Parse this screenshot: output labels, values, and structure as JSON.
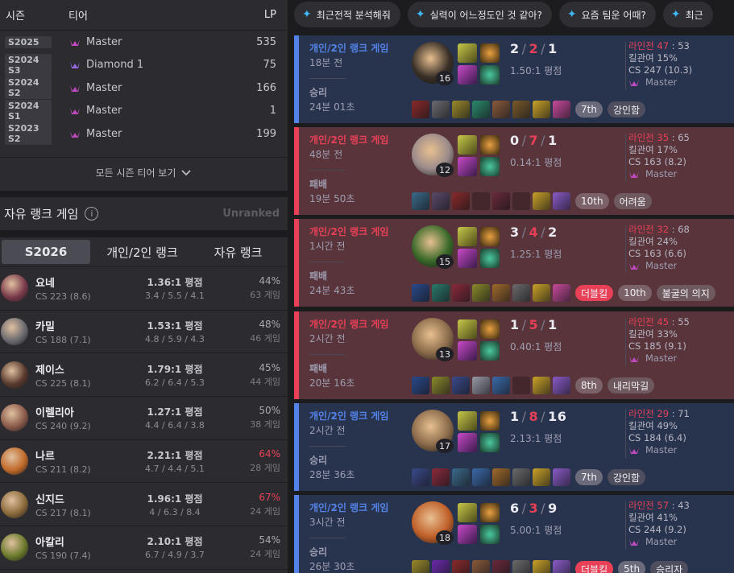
{
  "season_table": {
    "headers": {
      "season": "시즌",
      "tier": "티어",
      "lp": "LP"
    },
    "rows": [
      {
        "season": "S2025",
        "tier": "Master",
        "lp": "535",
        "icon": "master-icon"
      },
      {
        "season": "S2024 S3",
        "tier": "Diamond 1",
        "lp": "75",
        "icon": "diamond-icon"
      },
      {
        "season": "S2024 S2",
        "tier": "Master",
        "lp": "166",
        "icon": "master-icon"
      },
      {
        "season": "S2024 S1",
        "tier": "Master",
        "lp": "1",
        "icon": "master-icon"
      },
      {
        "season": "S2023 S2",
        "tier": "Master",
        "lp": "199",
        "icon": "master-icon"
      }
    ],
    "all_seasons_label": "모든 시즌 티어 보기"
  },
  "flex_rank": {
    "title": "자유 랭크 게임",
    "status": "Unranked"
  },
  "champ_tabs": [
    "S2026",
    "개인/2인 랭크",
    "자유 랭크"
  ],
  "champions": [
    {
      "name": "요네",
      "cs": "CS 223 (8.6)",
      "kda": "1.36:1 평점",
      "kda_detail": "3.4 / 5.5 / 4.1",
      "winrate": "44%",
      "games": "63 게임",
      "red": false,
      "color": "#7a3a4a"
    },
    {
      "name": "카밀",
      "cs": "CS 188 (7.1)",
      "kda": "1.53:1 평점",
      "kda_detail": "4.8 / 5.9 / 4.3",
      "winrate": "48%",
      "games": "46 게임",
      "red": false,
      "color": "#6a6a70"
    },
    {
      "name": "제이스",
      "cs": "CS 225 (8.1)",
      "kda": "1.79:1 평점",
      "kda_detail": "6.2 / 6.4 / 5.3",
      "winrate": "45%",
      "games": "44 게임",
      "red": false,
      "color": "#5a3a2e"
    },
    {
      "name": "이렐리아",
      "cs": "CS 240 (9.2)",
      "kda": "1.27:1 평점",
      "kda_detail": "4.4 / 6.4 / 3.8",
      "winrate": "50%",
      "games": "38 게임",
      "red": false,
      "color": "#8a5a4a"
    },
    {
      "name": "나르",
      "cs": "CS 211 (8.2)",
      "kda": "2.21:1 평점",
      "kda_detail": "4.7 / 4.4 / 5.1",
      "winrate": "64%",
      "games": "28 게임",
      "red": true,
      "color": "#c06a2a"
    },
    {
      "name": "신지드",
      "cs": "CS 217 (8.1)",
      "kda": "1.96:1 평점",
      "kda_detail": "4 / 6.3 / 8.4",
      "winrate": "67%",
      "games": "24 게임",
      "red": true,
      "color": "#8a6a3a"
    },
    {
      "name": "아칼리",
      "cs": "CS 190 (7.4)",
      "kda": "2.10:1 평점",
      "kda_detail": "6.7 / 4.9 / 3.7",
      "winrate": "54%",
      "games": "24 게임",
      "red": false,
      "color": "#6a7a2a"
    }
  ],
  "suggestions": [
    "최근전적 분석해줘",
    "실력이 어느정도인 것 같아?",
    "요즘 팀운 어때?",
    "최근"
  ],
  "matches": [
    {
      "outcome": "win",
      "queue": "개인/2인 랭크 게임",
      "ago": "18분 전",
      "result": "승리",
      "duration": "24분 01초",
      "level": "16",
      "k": "2",
      "d": "2",
      "a": "1",
      "ratio": "1.50:1 평점",
      "lane": "라인전 47",
      "lane_b": "53",
      "kp": "킬관여 15%",
      "cs": "CS 247 (10.3)",
      "tier": "Master",
      "badges": [
        {
          "t": "7th",
          "c": "mvp"
        },
        {
          "t": "강인함",
          "c": "txt"
        }
      ],
      "champ_color": "#3a3028",
      "items": [
        "#8a2a2a",
        "#6a6a70",
        "#9a8a2a",
        "#2a8a6a",
        "#8a5a3a",
        "#7a5a2a",
        "#c9a227",
        "#c84a9a"
      ]
    },
    {
      "outcome": "loss",
      "queue": "개인/2인 랭크 게임",
      "ago": "48분 전",
      "result": "패배",
      "duration": "19분 50초",
      "level": "12",
      "k": "0",
      "d": "7",
      "a": "1",
      "ratio": "0.14:1 평점",
      "lane": "라인전 35",
      "lane_b": "65",
      "kp": "킬관여 17%",
      "cs": "CS 163 (8.2)",
      "tier": "Master",
      "badges": [
        {
          "t": "10th",
          "c": "mvp"
        },
        {
          "t": "어려움",
          "c": "txt"
        }
      ],
      "champ_color": "#9a8a8a",
      "items": [
        "#3a6a8a",
        "#5a4a6a",
        "#8a2a2a",
        "",
        "#6a2a3a",
        "",
        "#c9a227",
        "#8a5ac8"
      ]
    },
    {
      "outcome": "loss",
      "queue": "개인/2인 랭크 게임",
      "ago": "1시간 전",
      "result": "패배",
      "duration": "24분 43초",
      "level": "15",
      "k": "3",
      "d": "4",
      "a": "2",
      "ratio": "1.25:1 평점",
      "lane": "라인전 32",
      "lane_b": "68",
      "kp": "킬관여 24%",
      "cs": "CS 163 (6.6)",
      "tier": "Master",
      "badges": [
        {
          "t": "더블킬",
          "c": "dk"
        },
        {
          "t": "10th",
          "c": "mvp"
        },
        {
          "t": "불굴의 의지",
          "c": "txt"
        }
      ],
      "champ_color": "#3a6a2a",
      "items": [
        "#2a4a8a",
        "#2a7a6a",
        "#8a2a3a",
        "#8a8a2a",
        "#a06a2a",
        "#6a6a6a",
        "#c9a227",
        "#c84a9a"
      ]
    },
    {
      "outcome": "loss",
      "queue": "개인/2인 랭크 게임",
      "ago": "2시간 전",
      "result": "패배",
      "duration": "20분 16초",
      "level": "13",
      "k": "1",
      "d": "5",
      "a": "1",
      "ratio": "0.40:1 평점",
      "lane": "라인전 45",
      "lane_b": "55",
      "kp": "킬관여 33%",
      "cs": "CS 185 (9.1)",
      "tier": "Master",
      "badges": [
        {
          "t": "8th",
          "c": "mvp"
        },
        {
          "t": "내리막길",
          "c": "txt"
        }
      ],
      "champ_color": "#8a6a4a",
      "items": [
        "#2a4a8a",
        "#8a8a2a",
        "#3a4a8a",
        "#9a9aa8",
        "#3a6aaa",
        "",
        "#c9a227",
        "#8a5ac8"
      ]
    },
    {
      "outcome": "win",
      "queue": "개인/2인 랭크 게임",
      "ago": "2시간 전",
      "result": "승리",
      "duration": "28분 36초",
      "level": "17",
      "k": "1",
      "d": "8",
      "a": "16",
      "ratio": "2.13:1 평점",
      "lane": "라인전 29",
      "lane_b": "71",
      "kp": "킬관여 49%",
      "cs": "CS 184 (6.4)",
      "tier": "Master",
      "badges": [
        {
          "t": "7th",
          "c": "mvp"
        },
        {
          "t": "강인함",
          "c": "txt"
        }
      ],
      "champ_color": "#8a6a4a",
      "items": [
        "#3a4a8a",
        "#8a2a3a",
        "#3a6a8a",
        "#3a6aaa",
        "#a06a2a",
        "#6a6a6a",
        "#c9a227",
        "#8a5ac8"
      ]
    },
    {
      "outcome": "win",
      "queue": "개인/2인 랭크 게임",
      "ago": "3시간 전",
      "result": "승리",
      "duration": "26분 30초",
      "level": "18",
      "k": "6",
      "d": "3",
      "a": "9",
      "ratio": "5.00:1 평점",
      "lane": "라인전 57",
      "lane_b": "43",
      "kp": "킬관여 41%",
      "cs": "CS 244 (9.2)",
      "tier": "Master",
      "badges": [
        {
          "t": "더블킬",
          "c": "dk"
        },
        {
          "t": "5th",
          "c": "mvp"
        },
        {
          "t": "승리자",
          "c": "txt"
        }
      ],
      "champ_color": "#c0602a",
      "items": [
        "#9a8a2a",
        "#6a2aaa",
        "#8a2a2a",
        "#8a5a3a",
        "#6a2a3a",
        "#6a6a6a",
        "#c9a227",
        "#8a5ac8"
      ]
    }
  ]
}
